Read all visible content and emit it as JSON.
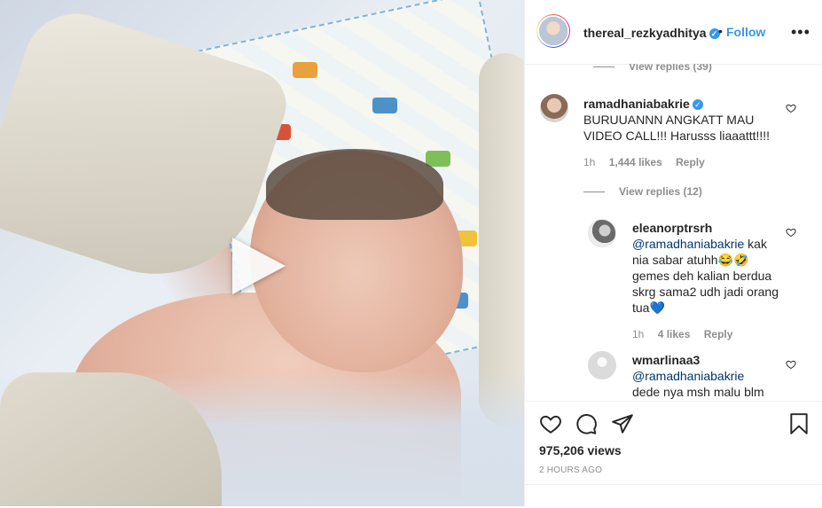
{
  "header": {
    "username": "thereal_rezkyadhitya",
    "dot": "•",
    "follow_label": "Follow",
    "more_icon": "more-options-icon"
  },
  "comments": {
    "top_view_replies": "View replies (39)",
    "items": [
      {
        "username": "ramadhaniabakrie",
        "verified": true,
        "text": "BURUUANNN ANGKATT MAU VIDEO CALL!!! Harusss liaaattt!!!!",
        "time": "1h",
        "likes": "1,444 likes",
        "reply_label": "Reply",
        "view_replies": "View replies (12)"
      },
      {
        "username": "eleanorptrsrh",
        "mention": "@ramadhaniabakrie",
        "text": "kak nia sabar atuhh😂🤣 gemes deh kalian berdua skrg sama2 udh jadi orang tua💙",
        "time": "1h",
        "likes": "4 likes",
        "reply_label": "Reply"
      },
      {
        "username": "wmarlinaa3",
        "mention": "@ramadhaniabakrie",
        "text": "dede nya msh malu blm"
      }
    ]
  },
  "actions": {
    "views": "975,206 views",
    "timestamp": "2 HOURS AGO",
    "icons": [
      "heart-icon",
      "comment-icon",
      "share-icon",
      "bookmark-icon"
    ]
  },
  "colors": {
    "link_blue": "#3897f0",
    "mention_blue": "#00376b",
    "muted": "#8e8e8e",
    "text": "#262626"
  }
}
